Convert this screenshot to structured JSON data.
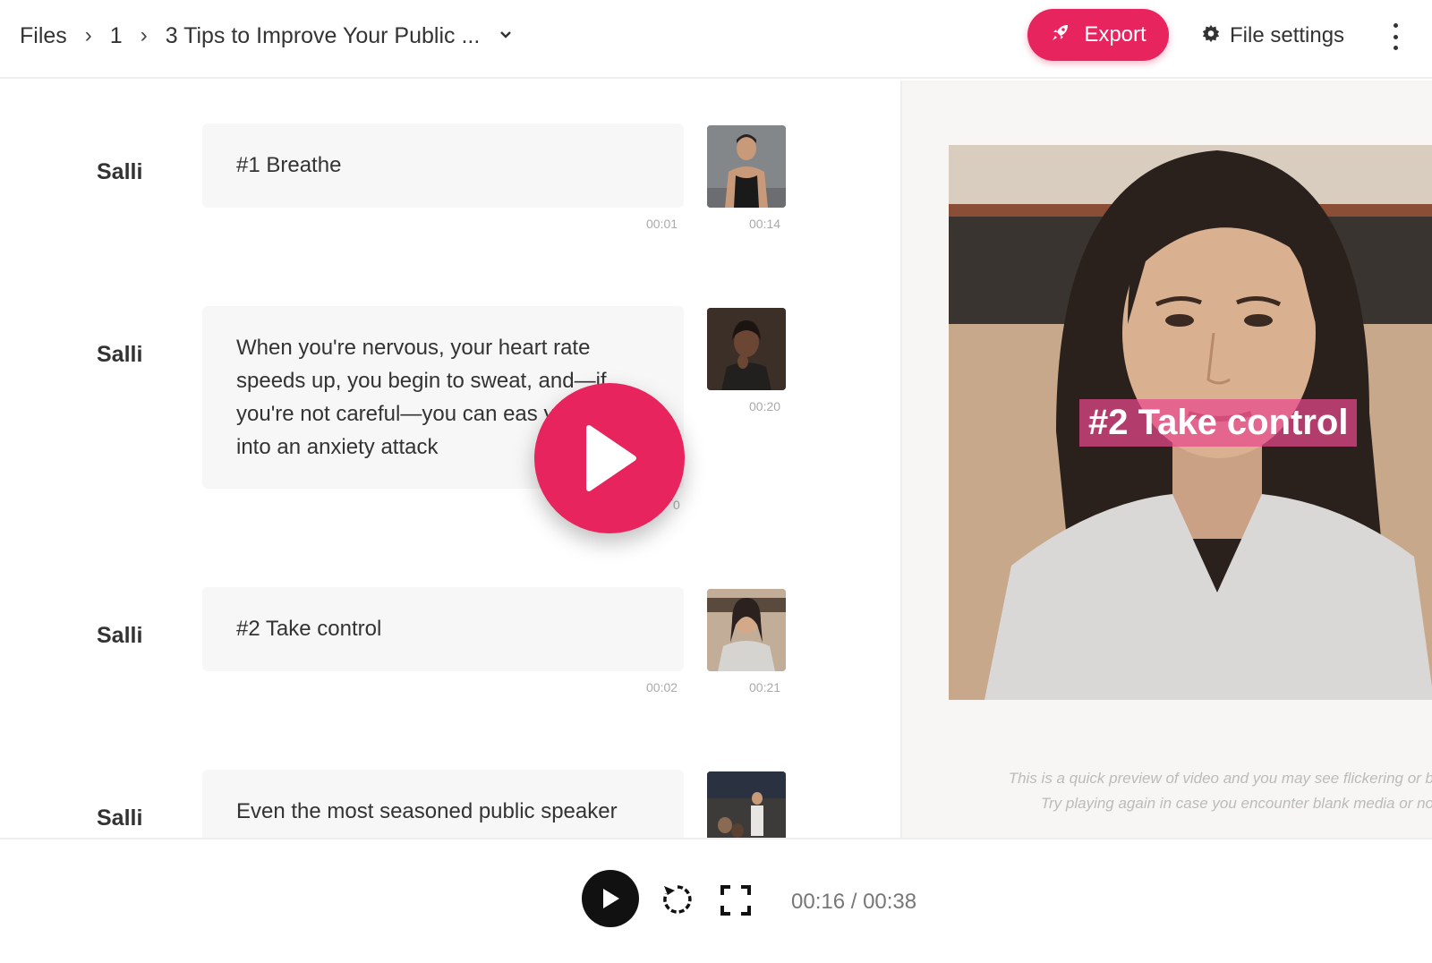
{
  "breadcrumb": {
    "items": [
      "Files",
      "1",
      "3 Tips to Improve Your Public ..."
    ]
  },
  "header": {
    "export_label": "Export",
    "file_settings_label": "File settings",
    "accent_color": "#e8245f"
  },
  "script": {
    "rows": [
      {
        "speaker": "Salli",
        "text": "#1 Breathe",
        "text_time": "00:01",
        "clip_time": "00:14",
        "thumb": "man-black-tank-top"
      },
      {
        "speaker": "Salli",
        "text": "When you're nervous, your heart rate speeds up, you begin to sweat, and—if you're not careful—you can eas yourself into an anxiety attack",
        "text_time": "0",
        "clip_time": "00:20",
        "thumb": "woman-thinking"
      },
      {
        "speaker": "Salli",
        "text": "#2 Take control",
        "text_time": "00:02",
        "clip_time": "00:21",
        "thumb": "woman-grey-shirt"
      },
      {
        "speaker": "Salli",
        "text": "Even the most seasoned public speaker",
        "text_time": "",
        "clip_time": "",
        "thumb": "man-presenting"
      }
    ]
  },
  "preview": {
    "caption": "#2 Take control",
    "note_line1": "This is a quick preview of video and you may see flickering or b",
    "note_line2": "Try playing again in case you encounter blank media or no"
  },
  "player": {
    "time": "00:16 / 00:38"
  },
  "icons": {
    "export": "rocket-icon",
    "settings": "gear-icon",
    "more": "kebab-icon",
    "play": "play-icon",
    "replay": "replay-icon",
    "fullscreen": "fullscreen-icon"
  }
}
